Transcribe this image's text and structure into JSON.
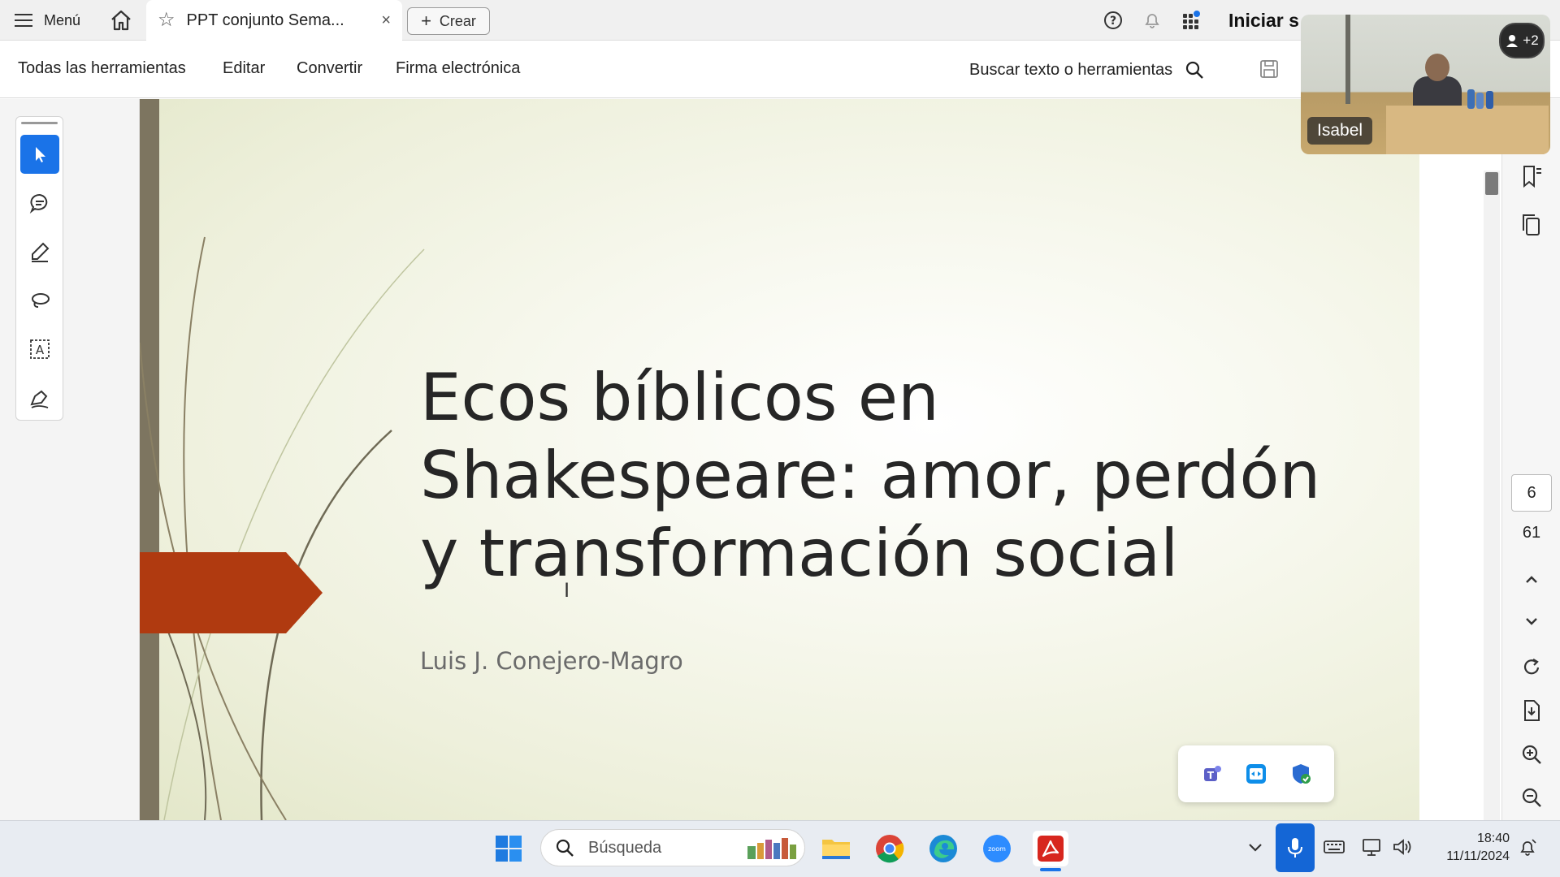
{
  "tabbar": {
    "menu_label": "Menú",
    "tab_title": "PPT conjunto Sema...",
    "close_symbol": "×",
    "create_label": "Crear",
    "signin_label": "Iniciar s"
  },
  "toolbar": {
    "all_tools": "Todas las herramientas",
    "edit": "Editar",
    "convert": "Convertir",
    "esign": "Firma electrónica",
    "search_tools": "Buscar texto o herramientas"
  },
  "left_tools": [
    "select-tool",
    "comment-tool",
    "highlight-tool",
    "lasso-tool",
    "text-select-tool",
    "sign-tool"
  ],
  "slide": {
    "title": "Ecos bíblicos en Shakespeare: amor, perdón y transformación social",
    "author": "Luis J. Conejero-Magro",
    "accent_color": "#b03a10",
    "bar_color": "#7d7560"
  },
  "pager": {
    "current_page": "6",
    "total_pages": "61"
  },
  "video": {
    "participant_name": "Isabel",
    "participants_extra": "+2"
  },
  "taskbar": {
    "search_placeholder": "Búsqueda",
    "time": "18:40",
    "date": "11/11/2024"
  },
  "colors": {
    "active_tool": "#1a73e8",
    "mic_active": "#1466d6"
  }
}
